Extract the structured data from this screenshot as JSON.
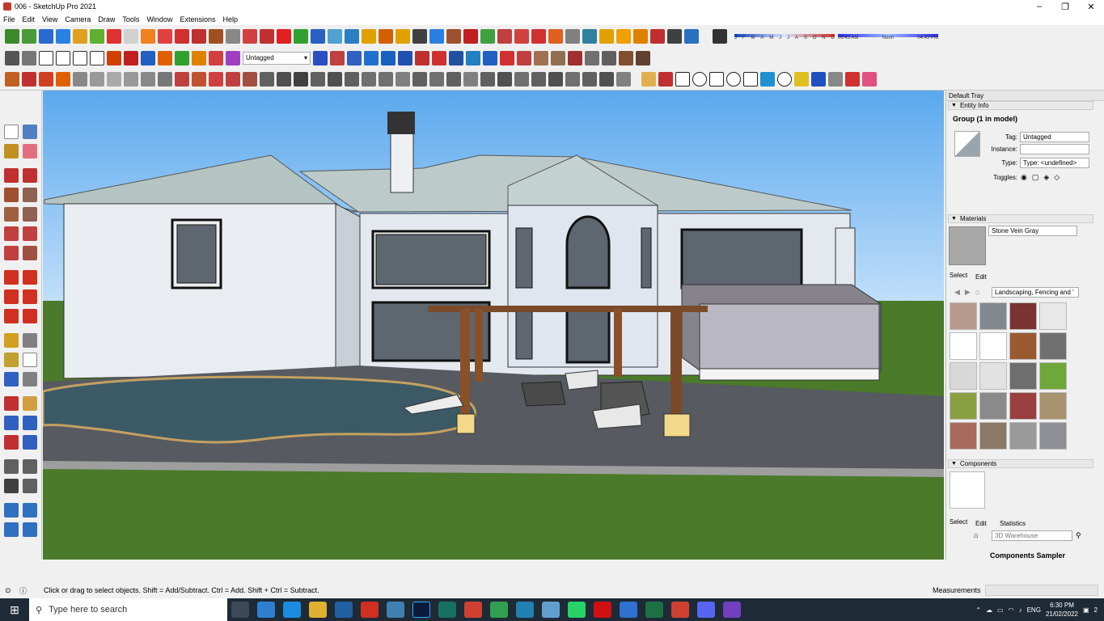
{
  "window": {
    "title": "006 - SketchUp Pro 2021",
    "minimize": "–",
    "maximize": "❐",
    "close": "✕"
  },
  "menu": [
    "File",
    "Edit",
    "View",
    "Camera",
    "Draw",
    "Tools",
    "Window",
    "Extensions",
    "Help"
  ],
  "toolbar": {
    "tag_dropdown": "Untagged",
    "shadow_months": [
      "J",
      "F",
      "M",
      "A",
      "M",
      "J",
      "J",
      "A",
      "S",
      "O",
      "N",
      "D"
    ],
    "shadow_time_start": "06:43 AM",
    "shadow_time_mid": "Noon",
    "shadow_time_end": "04:45 PM"
  },
  "tray": {
    "title": "Default Tray",
    "entity_info": {
      "header": "Entity Info",
      "selection": "Group (1 in model)",
      "tag_label": "Tag:",
      "tag_value": "Untagged",
      "instance_label": "Instance:",
      "instance_value": "",
      "type_label": "Type:",
      "type_value": "Type: <undefined>",
      "toggles_label": "Toggles:"
    },
    "materials": {
      "header": "Materials",
      "current": "Stone Vein Gray",
      "tab_select": "Select",
      "tab_edit": "Edit",
      "library": "Landscaping, Fencing and '",
      "swatch_colors": [
        "#b89a8f",
        "#808890",
        "#7a3232",
        "#e8e8e8",
        "#ffffff",
        "#ffffff",
        "#9a5a30",
        "#707070",
        "#d8d8d8",
        "#e2e2e2",
        "#6e6e6e",
        "#6fa83a",
        "#8aa040",
        "#8a8a8a",
        "#9a4040",
        "#a89270",
        "#a86a5a",
        "#8c7866",
        "#9a9a9a",
        "#8e8e96"
      ]
    },
    "components": {
      "header": "Components",
      "tab_select": "Select",
      "tab_edit": "Edit",
      "tab_statistics": "Statistics",
      "search_placeholder": "3D Warehouse",
      "collection": "Components Sampler"
    }
  },
  "status": {
    "message": "Click or drag to select objects. Shift = Add/Subtract. Ctrl = Add. Shift + Ctrl = Subtract.",
    "measurements_label": "Measurements",
    "measurements_value": ""
  },
  "taskbar": {
    "search_placeholder": "Type here to search",
    "language": "ENG",
    "time": "6:30 PM",
    "date": "21/02/2022",
    "notifications": "2"
  },
  "colors": {
    "accent_blue": "#1f5fbf",
    "sky": "#a9d4f5",
    "grass": "#4a7a2a",
    "wall": "#eaeef4",
    "roof": "#b8c8c8",
    "patio": "#575a60"
  }
}
